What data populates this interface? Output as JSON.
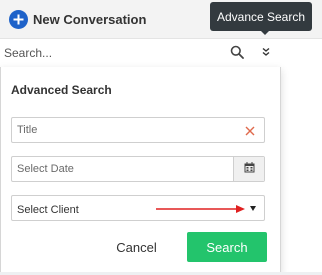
{
  "header": {
    "new_conversation_label": "New Conversation",
    "plus_icon": "plus-circle-icon",
    "tooltip_text": "Advance Search"
  },
  "search": {
    "placeholder": "Search...",
    "search_icon": "search-icon",
    "advanced_toggle_icon": "double-chevron-down-icon"
  },
  "advanced": {
    "title": "Advanced Search",
    "title_field": {
      "placeholder": "Title",
      "clear_icon": "close-icon"
    },
    "date_field": {
      "placeholder": "Select Date",
      "calendar_icon": "calendar-icon"
    },
    "client_select": {
      "selected": "Select Client",
      "caret_icon": "caret-down-icon"
    },
    "cancel_label": "Cancel",
    "search_label": "Search"
  },
  "colors": {
    "accent_blue": "#1e62c9",
    "search_green": "#23c46c",
    "annotation_red": "#e02020",
    "tooltip_bg": "#333a3f"
  }
}
